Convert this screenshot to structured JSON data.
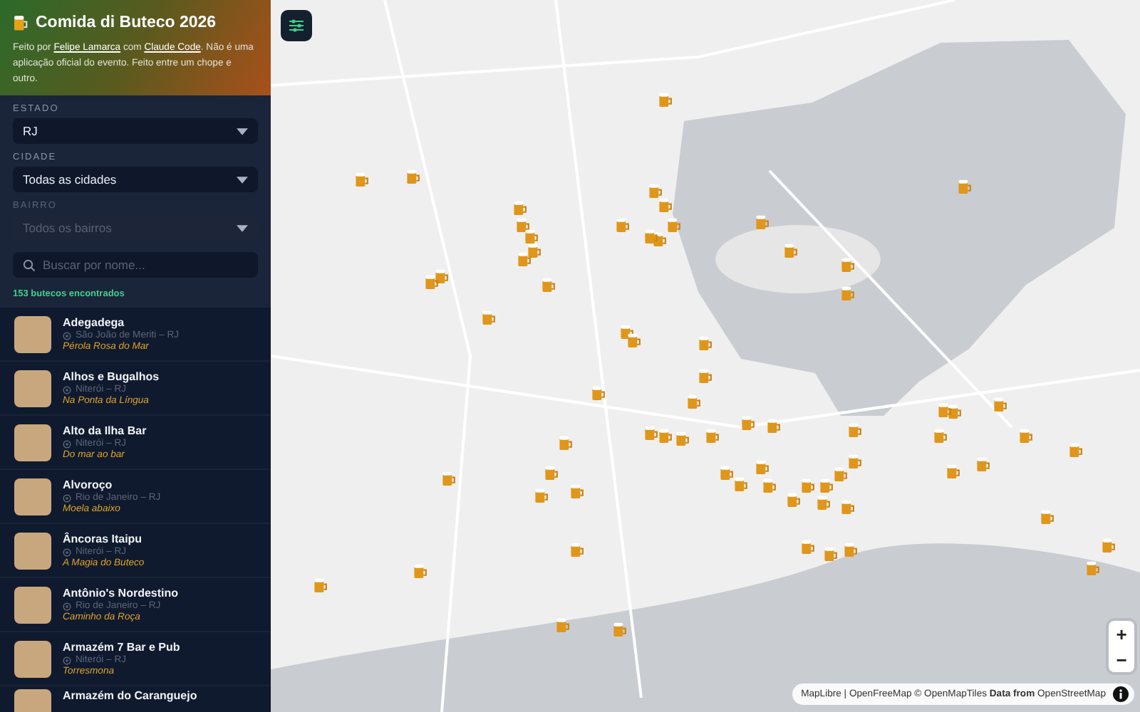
{
  "sidebar": {
    "title": "Comida di Buteco 2026",
    "intro": [
      {
        "text": "Feito por ",
        "kind": "text"
      },
      {
        "text": "Felipe Lamarca",
        "kind": "link"
      },
      {
        "text": " com ",
        "kind": "text"
      },
      {
        "text": "Claude Code",
        "kind": "link"
      },
      {
        "text": ". Não é uma aplicação oficial do evento. Feito entre um chope e outro.",
        "kind": "text"
      }
    ],
    "filters": [
      {
        "label": "ESTADO",
        "value": "RJ",
        "disabled": false
      },
      {
        "label": "CIDADE",
        "value": "Todas as cidades",
        "disabled": false
      },
      {
        "label": "BAIRRO",
        "value": "Todos os bairros",
        "disabled": true
      }
    ],
    "search": {
      "placeholder": "Buscar por nome..."
    },
    "count": "153 butecos encontrados",
    "items": [
      {
        "name": "Adegadega",
        "location": "São João de Meriti – RJ",
        "dish": "Pérola Rosa do Mar"
      },
      {
        "name": "Alhos e Bugalhos",
        "location": "Niterói – RJ",
        "dish": "Na Ponta da Língua"
      },
      {
        "name": "Alto da Ilha Bar",
        "location": "Niterói – RJ",
        "dish": "Do mar ao bar"
      },
      {
        "name": "Alvoroço",
        "location": "Rio de Janeiro – RJ",
        "dish": "Moela abaixo"
      },
      {
        "name": "Âncoras Itaipu",
        "location": "Niterói – RJ",
        "dish": "A Magia do Buteco"
      },
      {
        "name": "Antônio's Nordestino",
        "location": "Rio de Janeiro – RJ",
        "dish": "Caminho da Roça"
      },
      {
        "name": "Armazém 7 Bar e Pub",
        "location": "Niterói – RJ",
        "dish": "Torresmona"
      },
      {
        "name": "Armazém do Caranguejo"
      }
    ]
  },
  "map": {
    "zoom_buttons": [
      "+",
      "−"
    ],
    "attribution": "MapLibre | OpenFreeMap © OpenMapTiles **Data from** OpenStreetMap"
  }
}
